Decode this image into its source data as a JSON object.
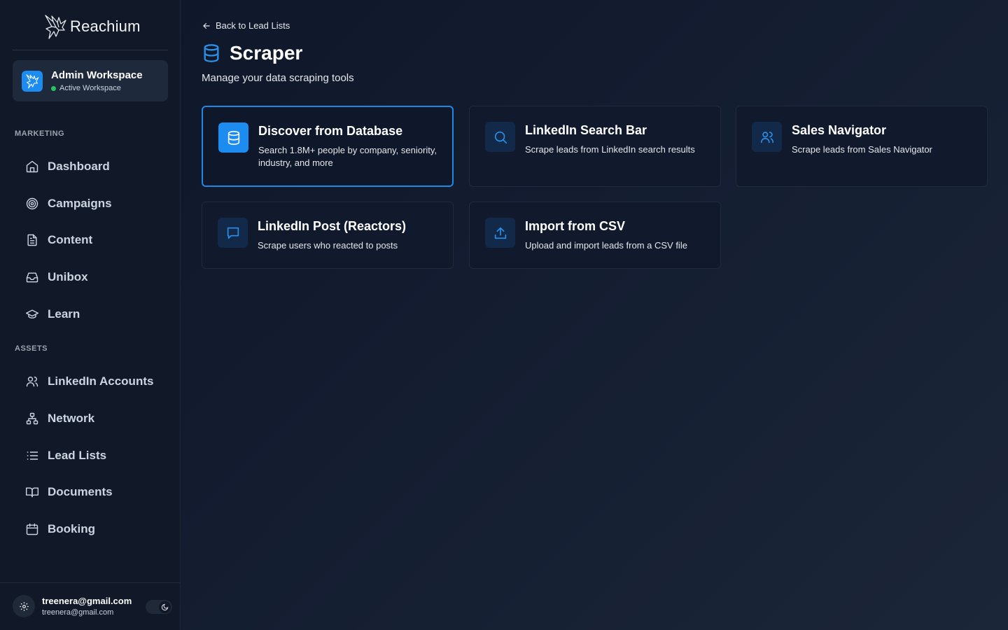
{
  "brand": {
    "name": "Reachium"
  },
  "workspace": {
    "name": "Admin Workspace",
    "status": "Active Workspace"
  },
  "sidebar": {
    "sections": [
      {
        "label": "MARKETING"
      },
      {
        "label": "ASSETS"
      }
    ],
    "items": [
      {
        "label": "Dashboard",
        "icon": "home-icon"
      },
      {
        "label": "Campaigns",
        "icon": "target-icon"
      },
      {
        "label": "Content",
        "icon": "document-icon"
      },
      {
        "label": "Unibox",
        "icon": "inbox-icon"
      },
      {
        "label": "Learn",
        "icon": "graduation-cap-icon"
      },
      {
        "label": "LinkedIn Accounts",
        "icon": "users-icon"
      },
      {
        "label": "Network",
        "icon": "network-icon"
      },
      {
        "label": "Lead Lists",
        "icon": "list-icon"
      },
      {
        "label": "Documents",
        "icon": "book-icon"
      },
      {
        "label": "Booking",
        "icon": "calendar-icon"
      }
    ]
  },
  "user": {
    "name": "treenera@gmail.com",
    "email": "treenera@gmail.com"
  },
  "header": {
    "back_label": "Back to Lead Lists",
    "title": "Scraper",
    "subtitle": "Manage your data scraping tools"
  },
  "cards": [
    {
      "title": "Discover from Database",
      "desc": "Search 1.8M+ people by company, seniority, industry, and more",
      "icon": "database-icon",
      "selected": true
    },
    {
      "title": "LinkedIn Search Bar",
      "desc": "Scrape leads from LinkedIn search results",
      "icon": "search-icon"
    },
    {
      "title": "Sales Navigator",
      "desc": "Scrape leads from Sales Navigator",
      "icon": "users-icon"
    },
    {
      "title": "LinkedIn Post (Reactors)",
      "desc": "Scrape users who reacted to posts",
      "icon": "message-icon"
    },
    {
      "title": "Import from CSV",
      "desc": "Upload and import leads from a CSV file",
      "icon": "upload-icon"
    }
  ],
  "colors": {
    "accent": "#1d8cf0",
    "status_active": "#22c55e",
    "background": "#0f172a"
  }
}
